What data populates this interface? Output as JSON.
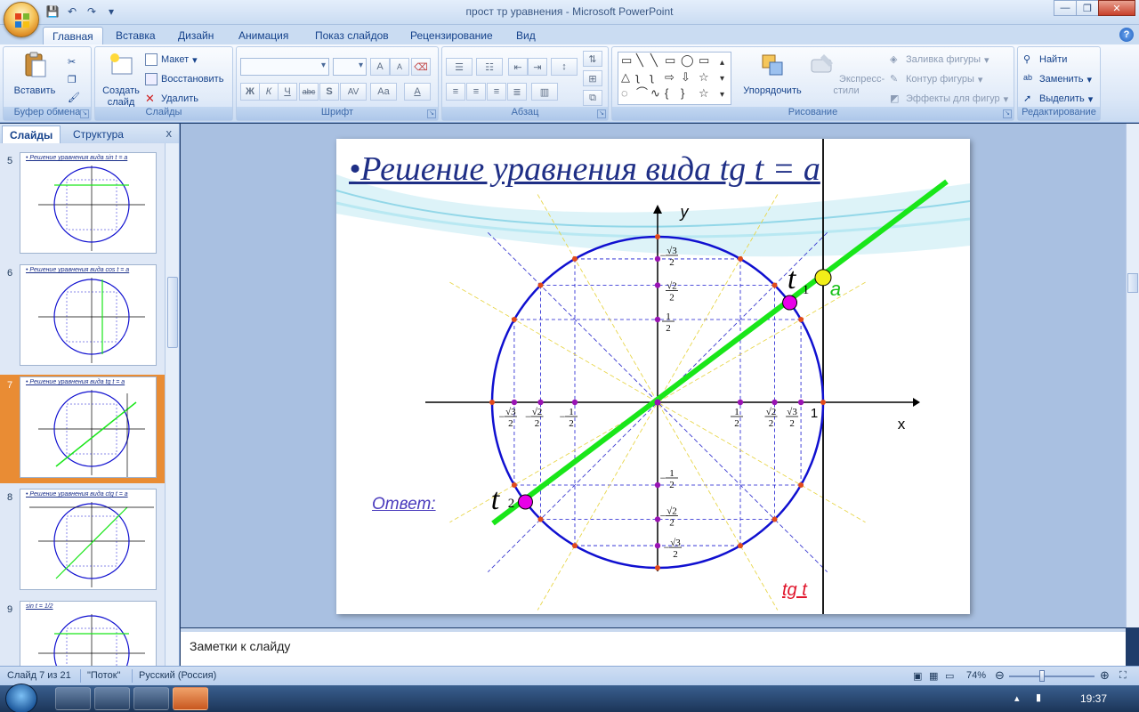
{
  "window": {
    "title": "прост тр уравнения - Microsoft PowerPoint",
    "controls": [
      "—",
      "❐",
      "✕"
    ]
  },
  "quick_access": {
    "save": "💾",
    "undo": "↶",
    "redo": "↷",
    "more": "▾"
  },
  "tabs": [
    "Главная",
    "Вставка",
    "Дизайн",
    "Анимация",
    "Показ слайдов",
    "Рецензирование",
    "Вид"
  ],
  "help": "?",
  "ribbon": {
    "clipboard": {
      "label": "Буфер обмена",
      "paste": "Вставить"
    },
    "slides": {
      "label": "Слайды",
      "new_slide": "Создать слайд",
      "layout": "Макет",
      "reset": "Восстановить",
      "delete": "Удалить"
    },
    "font": {
      "label": "Шрифт",
      "grow": "A",
      "shrink": "A",
      "bold": "Ж",
      "italic": "К",
      "underline": "Ч",
      "strike": "abc",
      "shadow": "S",
      "spacing": "AV",
      "case": "Aa",
      "color": "A"
    },
    "paragraph": {
      "label": "Абзац"
    },
    "drawing": {
      "label": "Рисование",
      "arrange": "Упорядочить",
      "quick_styles": "Экспресс-стили",
      "fill": "Заливка фигуры",
      "outline": "Контур фигуры",
      "effects": "Эффекты для фигур"
    },
    "editing": {
      "label": "Редактирование",
      "find": "Найти",
      "replace": "Заменить",
      "select": "Выделить"
    }
  },
  "left_pane": {
    "tabs": [
      "Слайды",
      "Структура"
    ],
    "close": "x",
    "thumbnails": [
      {
        "num": "5",
        "title": "• Решение уравнения вида sin t = a"
      },
      {
        "num": "6",
        "title": "• Решение уравнения вида cos t = a"
      },
      {
        "num": "7",
        "title": "• Решение уравнения вида tg t = a"
      },
      {
        "num": "8",
        "title": "• Решение уравнения вида ctg t = a"
      },
      {
        "num": "9",
        "title": "sin t = 1/2"
      }
    ]
  },
  "slide": {
    "title": "•Решение уравнения вида tg t = a",
    "answer_label": "Ответ:",
    "tg_label": "tg t",
    "axis_x": "x",
    "axis_y": "y",
    "one": "1",
    "t1": "t",
    "t1_sub": "1",
    "t2": "t",
    "t2_sub": "2",
    "a_label": "a",
    "y_ticks_top": [
      "√3",
      "2",
      "√2",
      "2",
      "1",
      "2"
    ],
    "y_ticks_bottom": [
      "1",
      "2",
      "√2",
      "2",
      "√3",
      "2"
    ],
    "x_ticks_right": [
      "1",
      "2",
      "√2",
      "2",
      "√3",
      "2"
    ],
    "x_ticks_left": [
      "√3",
      "2",
      "√2",
      "2",
      "1",
      "2"
    ],
    "minus": "−",
    "colors": {
      "circle": "#1010d0",
      "line": "#19e619",
      "point_t": "#e800e8",
      "point_a": "#f2ee18",
      "dots": "#e04a1c"
    }
  },
  "notes": {
    "placeholder": "Заметки к слайду"
  },
  "status": {
    "slide": "Слайд 7 из 21",
    "theme": "\"Поток\"",
    "language": "Русский (Россия)",
    "zoom": "74%"
  },
  "taskbar": {
    "clock": "19:37"
  }
}
